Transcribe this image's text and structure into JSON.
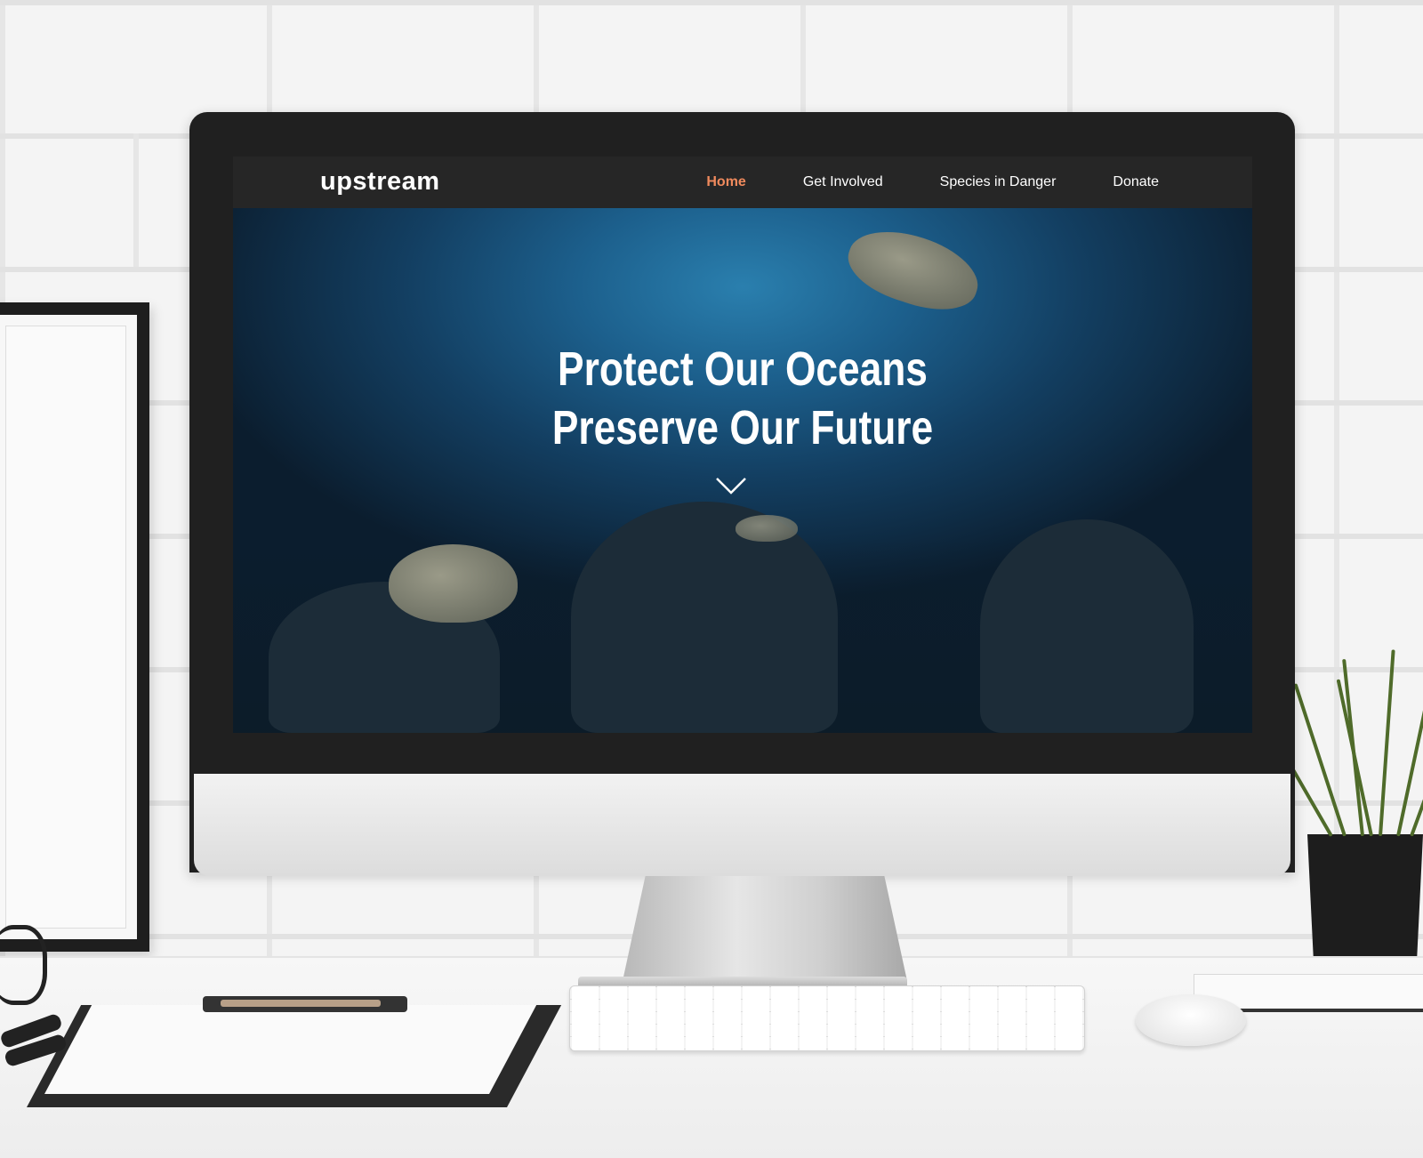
{
  "site": {
    "logo": "upstream",
    "nav": [
      {
        "label": "Home",
        "active": true
      },
      {
        "label": "Get Involved",
        "active": false
      },
      {
        "label": "Species in Danger",
        "active": false
      },
      {
        "label": "Donate",
        "active": false
      }
    ],
    "hero": {
      "line1": "Protect Our Oceans",
      "line2": "Preserve Our Future",
      "scroll_icon": "chevron-down-icon"
    }
  },
  "colors": {
    "nav_bg": "#262626",
    "active_link": "#f08a5d",
    "hero_blue": "#1c5f8c"
  }
}
